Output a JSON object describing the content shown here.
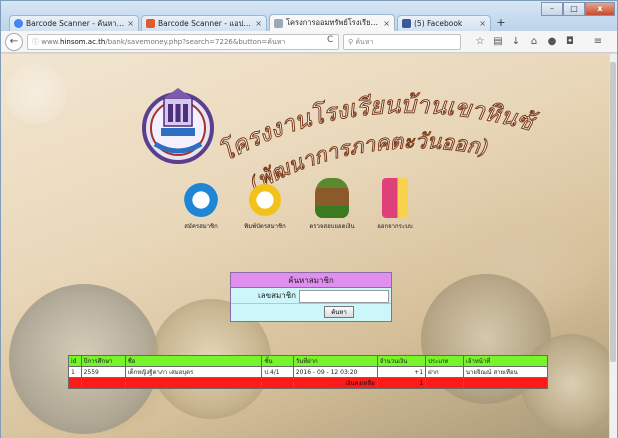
{
  "browser": {
    "tabs": [
      {
        "title": "Barcode Scanner - ค้นหาด้ว...",
        "icon": "google-icon",
        "color": "#4285f4"
      },
      {
        "title": "Barcode Scanner - แอปพลิ...",
        "icon": "play-store-icon",
        "color": "#e05a2b"
      },
      {
        "title": "โครงการออมทรัพย์โรงเรียนบ้าน...",
        "icon": "page-icon",
        "color": "#9aa9b8"
      },
      {
        "title": "(5) Facebook",
        "icon": "facebook-icon",
        "color": "#3b5998"
      }
    ],
    "new_tab": "+",
    "url_prefix": "www.",
    "url_host": "hinsom.ac.th",
    "url_path": "/bank/savemoney.php?search=7226&button=ค้นหา",
    "search_placeholder": "ค้นหา",
    "window_buttons": [
      "–",
      "□",
      "x"
    ]
  },
  "page": {
    "logo_text": "โรงเรียนบ้านเขาหินซ้อน",
    "banner_line1": "โครงงานโรงเรียนบ้านเขาหินซ้อน",
    "banner_line2": "(พัฒนาการภาคตะวันออก)",
    "menu": [
      {
        "label": "สมัครสมาชิก",
        "icon": "doraemon-icon"
      },
      {
        "label": "พิมพ์บัตรสมาชิก",
        "icon": "cartoon-icon"
      },
      {
        "label": "ตรวจสอบยอดเงิน",
        "icon": "farmer-icon"
      },
      {
        "label": "ออกจากระบบ",
        "icon": "door-icon"
      }
    ],
    "search_box": {
      "title": "ค้นหาสมาชิก",
      "member_label": "เลขสมาชิก",
      "member_value": "",
      "button_label": "ค้นหา"
    },
    "table": {
      "headers": [
        "id",
        "ปีการศึกษา",
        "ชื่อ",
        "ชั้น",
        "วันที่ฝาก",
        "จำนวนเงิน",
        "ประเภท",
        "เจ้าหน้าที่"
      ],
      "rows": [
        [
          "1",
          "2559",
          "เด็กหญิงฐิตาภา เสมอบุตร",
          "ป.4/1",
          "2016 - 09 - 12 03:20",
          "+1",
          "ฝาก",
          "นายจิณณ์ สายเทือน"
        ]
      ],
      "total_label": "เงินคงเหลือ",
      "total_value": "1"
    }
  }
}
